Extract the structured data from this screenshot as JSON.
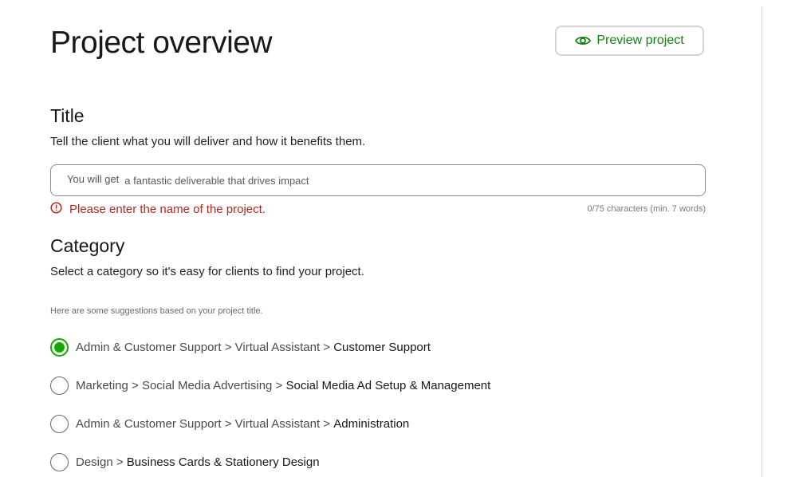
{
  "page": {
    "title": "Project overview",
    "preview_button": {
      "label": "Preview project",
      "icon": "eye-icon",
      "color": "#14820f"
    }
  },
  "title_section": {
    "heading": "Title",
    "description": "Tell the client what you will deliver and how it benefits them.",
    "input": {
      "prefix": "You will get",
      "value": "",
      "placeholder": "a fantastic deliverable that drives impact"
    },
    "error": {
      "icon": "alert-circle-icon",
      "message": "Please enter the name of the project.",
      "color": "#b3261e"
    },
    "char_count": "0/75 characters (min. 7 words)"
  },
  "category_section": {
    "heading": "Category",
    "description": "Select a category so it's easy for clients to find your project.",
    "suggestions_note": "Here are some suggestions based on your project title.",
    "options": [
      {
        "path": "Admin & Customer Support > Virtual Assistant > ",
        "leaf": "Customer Support",
        "selected": true
      },
      {
        "path": "Marketing > Social Media Advertising > ",
        "leaf": "Social Media Ad Setup & Management",
        "selected": false
      },
      {
        "path": "Admin & Customer Support > Virtual Assistant > ",
        "leaf": "Administration",
        "selected": false
      },
      {
        "path": "Design > ",
        "leaf": "Business Cards & Stationery Design",
        "selected": false
      }
    ],
    "accent_color": "#14a800"
  }
}
